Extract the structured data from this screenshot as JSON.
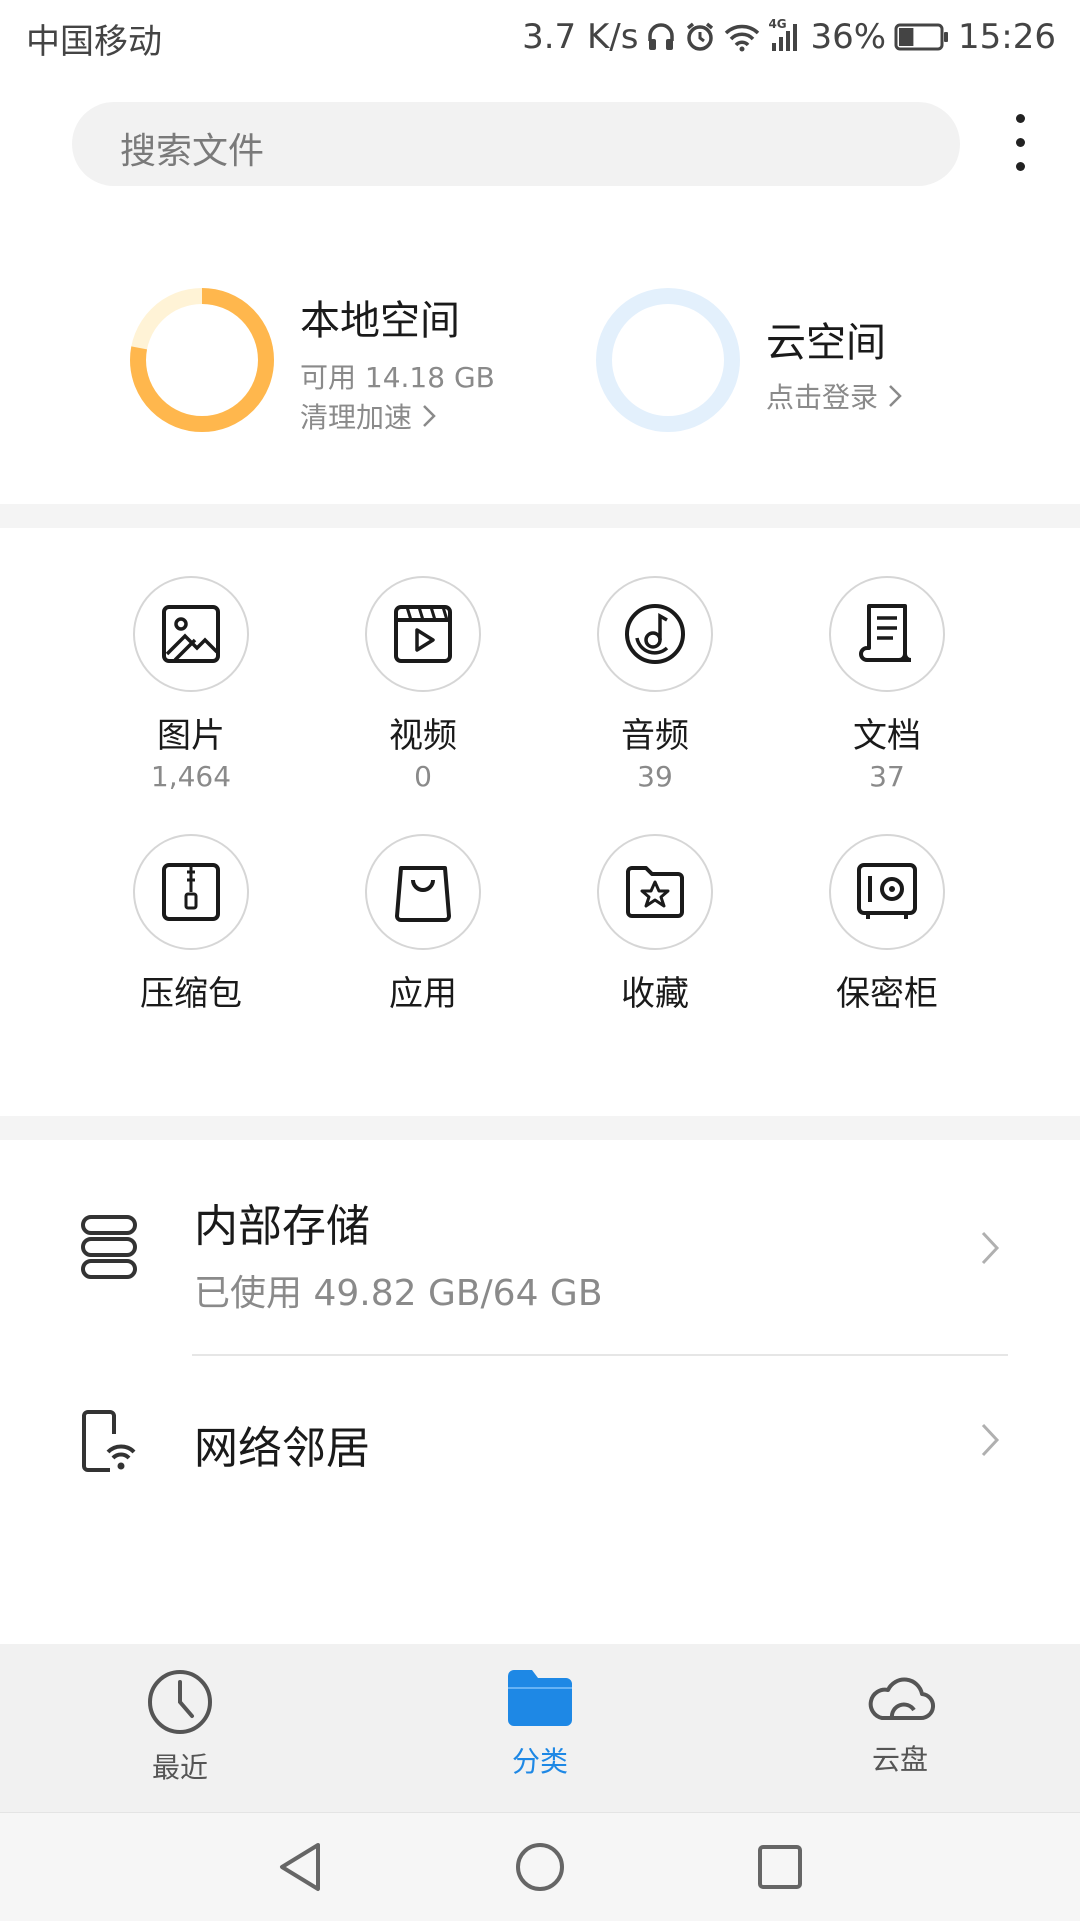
{
  "status_bar": {
    "carrier": "中国移动",
    "speed": "3.7 K/s",
    "network": "4G",
    "battery": "36%",
    "battery_level": 0.36,
    "time": "15:26",
    "icons": [
      "headset-icon",
      "alarm-icon",
      "wifi-icon",
      "signal-icon",
      "battery-icon"
    ]
  },
  "search": {
    "placeholder": "搜索文件"
  },
  "storage": {
    "local": {
      "title": "本地空间",
      "available": "可用 14.18 GB",
      "action": "清理加速",
      "ring_color": "#FFB74D",
      "ring_track": "#FFF3D6",
      "used_fraction": 0.78
    },
    "cloud": {
      "title": "云空间",
      "action": "点击登录",
      "ring_color": "#E3F0FC"
    }
  },
  "categories": [
    {
      "label": "图片",
      "count": "1,464",
      "icon": "image-icon"
    },
    {
      "label": "视频",
      "count": "0",
      "icon": "video-icon"
    },
    {
      "label": "音频",
      "count": "39",
      "icon": "music-icon"
    },
    {
      "label": "文档",
      "count": "37",
      "icon": "document-icon"
    },
    {
      "label": "压缩包",
      "icon": "archive-icon"
    },
    {
      "label": "应用",
      "icon": "shopping-bag-icon"
    },
    {
      "label": "收藏",
      "icon": "star-folder-icon"
    },
    {
      "label": "保密柜",
      "icon": "safe-icon"
    }
  ],
  "locations": {
    "internal": {
      "title": "内部存储",
      "usage": "已使用 49.82 GB/64 GB"
    },
    "network": {
      "title": "网络邻居"
    }
  },
  "tabs": [
    {
      "label": "最近",
      "icon": "clock-icon",
      "active": false
    },
    {
      "label": "分类",
      "icon": "folder-icon",
      "active": true
    },
    {
      "label": "云盘",
      "icon": "cloud-icon",
      "active": false
    }
  ],
  "colors": {
    "accent": "#1E88E5",
    "inactive": "#555555"
  },
  "nav": {
    "icons": [
      "back-icon",
      "home-icon",
      "recents-icon"
    ]
  }
}
